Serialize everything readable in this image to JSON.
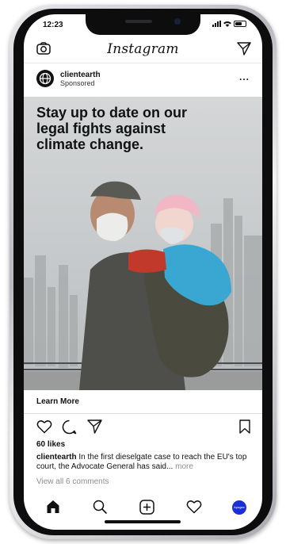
{
  "status_bar": {
    "time": "12:23"
  },
  "header": {
    "app_title": "Instagram",
    "camera_icon": "camera-icon",
    "send_icon": "paper-plane-icon"
  },
  "post": {
    "account": "clientearth",
    "sponsored_label": "Sponsored",
    "more_label": "...",
    "headline": "Stay up to date on our legal fights against climate change.",
    "cta_label": "Learn More",
    "likes": "60 likes",
    "caption_account": "clientearth",
    "caption_text": "In the first dieselgate case to reach the EU's top court, the Advocate General has said...",
    "caption_more": "more",
    "comments_link": "View all 6 comments"
  },
  "tab_bar": {
    "profile_label": "Apogee"
  },
  "colors": {
    "accent_profile": "#1b2fd6",
    "text": "#111111",
    "muted": "#8e8e8e"
  }
}
